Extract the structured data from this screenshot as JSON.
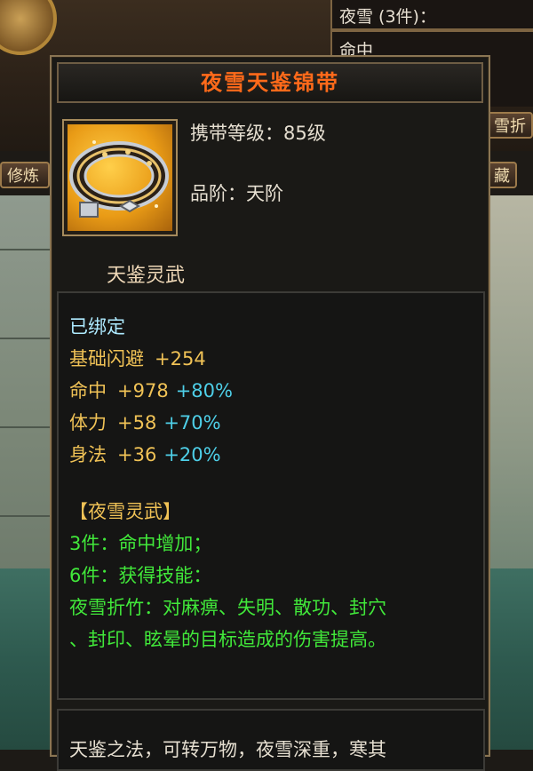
{
  "background": {
    "top_right_panel": {
      "set_label": "夜雪 (3件)：",
      "line2": "命中"
    },
    "left_button": "修炼",
    "right_button_a": "雪折",
    "right_button_b": "藏"
  },
  "tooltip": {
    "item_name": "夜雪天鉴锦带",
    "title_color": "#ff6a1a",
    "icon": "golden-belt-icon",
    "carry_level": "携带等级：85级",
    "grade": "品阶：天阶",
    "set_series": "天鉴灵武",
    "bound_status": "已绑定",
    "stats": [
      {
        "name": "基础闪避",
        "value": "+254",
        "percent": ""
      },
      {
        "name": "命中",
        "value": "+978",
        "percent": "+80%"
      },
      {
        "name": "体力",
        "value": "+58",
        "percent": "+70%"
      },
      {
        "name": "身法",
        "value": "+36",
        "percent": "+20%"
      }
    ],
    "set": {
      "name": "【夜雪灵武】",
      "bonus_3": "3件：命中增加；",
      "bonus_6": "6件：获得技能：",
      "skill_line1": "夜雪折竹：对麻痹、失明、散功、封穴",
      "skill_line2": "、封印、眩晕的目标造成的伤害提高。"
    },
    "description": "天鉴之法，可转万物，夜雪深重，寒其"
  },
  "colors": {
    "bound": "#aeeaff",
    "stat_name": "#f0c256",
    "percent": "#4ecfe8",
    "set_bonus": "#41e83a"
  }
}
